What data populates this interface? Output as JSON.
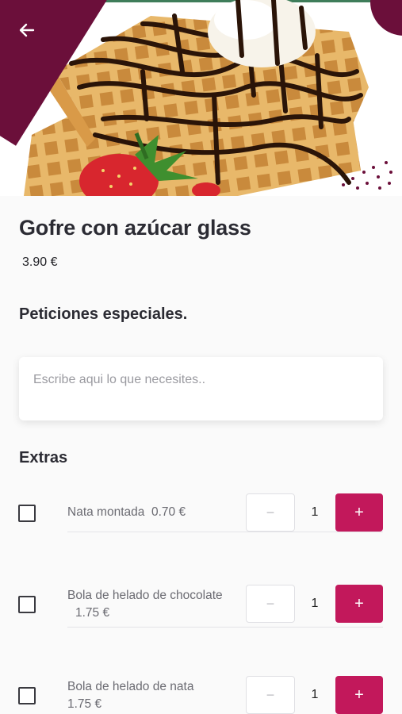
{
  "product": {
    "title": "Gofre con azúcar glass",
    "price": "3.90 €",
    "image": "waffle-with-chocolate-ice-cream-strawberry"
  },
  "special_requests": {
    "heading": "Peticiones especiales.",
    "placeholder": "Escribe aqui lo que necesites.."
  },
  "extras": {
    "heading": "Extras",
    "items": [
      {
        "name": "Nata montada",
        "price": "0.70 €",
        "quantity": "1",
        "checked": false
      },
      {
        "name": "Bola de helado de chocolate",
        "price": "1.75 €",
        "quantity": "1",
        "checked": false
      },
      {
        "name": "Bola de helado de nata",
        "price": "1.75 €",
        "quantity": "1",
        "checked": false
      }
    ]
  },
  "icons": {
    "back": "arrow-left-icon",
    "minus": "minus-icon",
    "plus": "plus-icon"
  },
  "colors": {
    "brand_dark": "#6b0f3a",
    "accent": "#c2185b",
    "text": "#2b2b33"
  }
}
